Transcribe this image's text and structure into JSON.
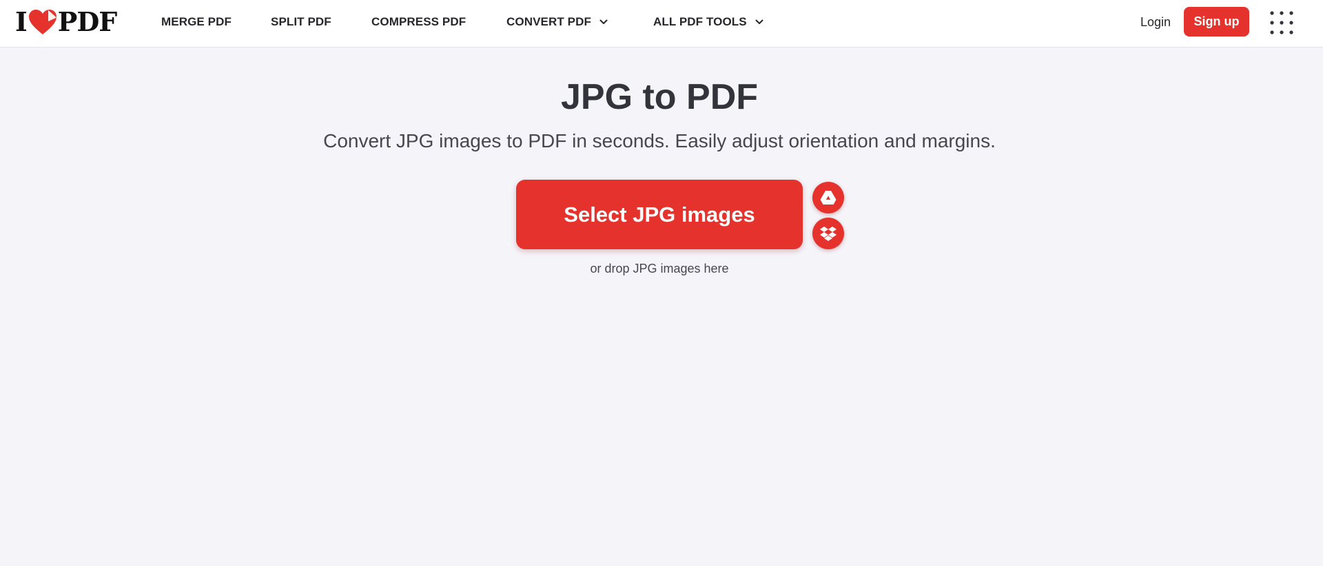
{
  "header": {
    "logo": {
      "prefix": "I",
      "suffix": "PDF",
      "heart_color": "#e5322d"
    },
    "nav": [
      {
        "label": "MERGE PDF"
      },
      {
        "label": "SPLIT PDF"
      },
      {
        "label": "COMPRESS PDF"
      },
      {
        "label": "CONVERT PDF",
        "has_dropdown": true
      },
      {
        "label": "ALL PDF TOOLS",
        "has_dropdown": true
      }
    ],
    "login_label": "Login",
    "signup_label": "Sign up",
    "apps_icon": "grid-menu-icon"
  },
  "main": {
    "title": "JPG to PDF",
    "subtitle": "Convert JPG images to PDF in seconds. Easily adjust orientation and margins.",
    "select_button_label": "Select JPG images",
    "cloud_sources": [
      {
        "icon": "google-drive-icon"
      },
      {
        "icon": "dropbox-icon"
      }
    ],
    "drop_hint": "or drop JPG images here"
  },
  "colors": {
    "accent": "#e5322d",
    "background": "#f4f4f9",
    "header_background": "#ffffff",
    "text": "#33333b"
  }
}
